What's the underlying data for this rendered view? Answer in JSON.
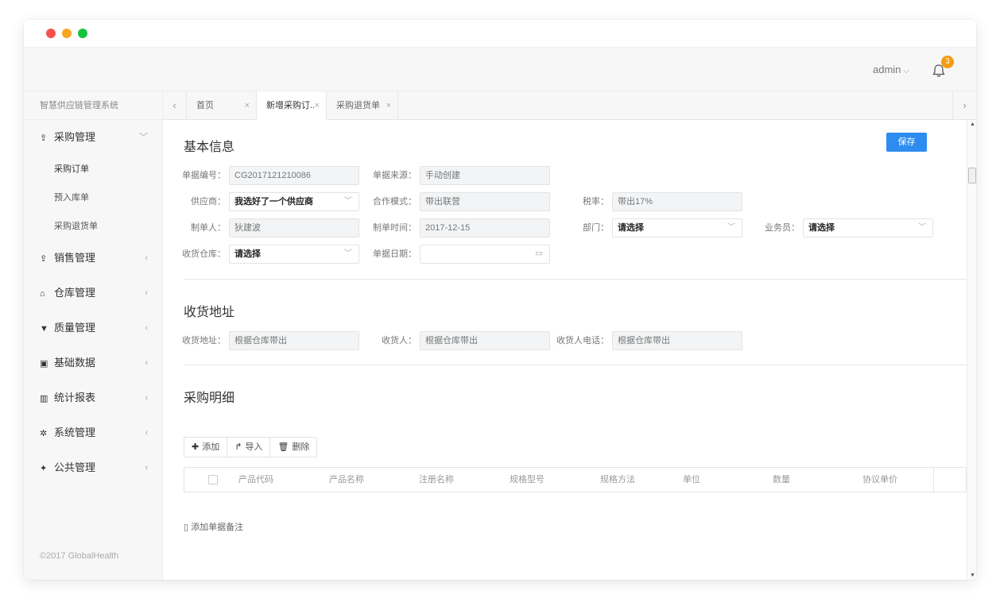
{
  "header": {
    "user": "admin",
    "notifications": "3"
  },
  "sidebar": {
    "title": "智慧供应链管理系统",
    "menu": [
      {
        "label": "采购管理",
        "icon": "upload-icon",
        "expanded": true,
        "children": [
          "采购订单",
          "预入库单",
          "采购退货单"
        ]
      },
      {
        "label": "销售管理",
        "icon": "upload-icon"
      },
      {
        "label": "仓库管理",
        "icon": "home-icon"
      },
      {
        "label": "质量管理",
        "icon": "shield-icon"
      },
      {
        "label": "基础数据",
        "icon": "card-icon"
      },
      {
        "label": "统计报表",
        "icon": "bar-chart-icon"
      },
      {
        "label": "系统管理",
        "icon": "gear-icon"
      },
      {
        "label": "公共管理",
        "icon": "pin-icon"
      }
    ],
    "copyright": "©2017 GlobalHealth"
  },
  "tabs": [
    {
      "label": "首页"
    },
    {
      "label": "新增采购订..",
      "active": true
    },
    {
      "label": "采购退货单"
    }
  ],
  "basic": {
    "title": "基本信息",
    "save": "保存",
    "fields": {
      "doc_no": {
        "label": "单据编号：",
        "value": "CG2017121210086"
      },
      "source": {
        "label": "单据来源：",
        "value": "手动创建"
      },
      "supplier": {
        "label": "供应商：",
        "value": "我选好了一个供应商"
      },
      "mode": {
        "label": "合作模式：",
        "value": "带出联营"
      },
      "tax": {
        "label": "税率：",
        "value": "带出17%"
      },
      "maker": {
        "label": "制单人：",
        "value": "狄建波"
      },
      "make_time": {
        "label": "制单时间：",
        "value": "2017-12-15"
      },
      "dept": {
        "label": "部门：",
        "value": "请选择"
      },
      "salesman": {
        "label": "业务员：",
        "value": "请选择"
      },
      "warehouse": {
        "label": "收货仓库：",
        "value": "请选择"
      },
      "doc_date": {
        "label": "单据日期：",
        "value": ""
      }
    }
  },
  "address": {
    "title": "收货地址",
    "fields": {
      "addr": {
        "label": "收货地址：",
        "value": "根据仓库带出"
      },
      "receiver": {
        "label": "收货人：",
        "value": "根据仓库带出"
      },
      "phone": {
        "label": "收货人电话：",
        "value": "根据仓库带出"
      }
    }
  },
  "details": {
    "title": "采购明细",
    "toolbar": {
      "add": "添加",
      "import": "导入",
      "delete": "删除"
    },
    "columns": [
      "产品代码",
      "产品名称",
      "注册名称",
      "规格型号",
      "规格方法",
      "单位",
      "数量",
      "协议单价"
    ],
    "remark": "添加单据备注"
  }
}
